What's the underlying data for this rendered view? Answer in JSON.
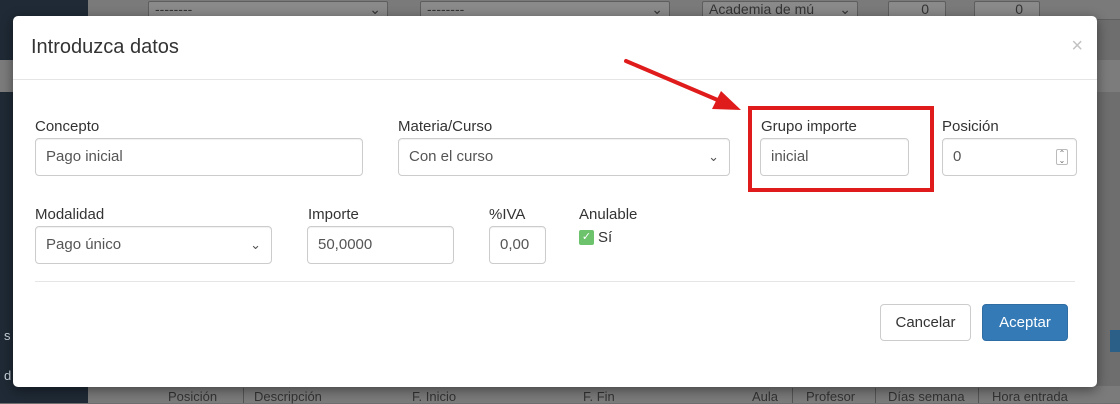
{
  "background": {
    "top_selects": [
      "--------",
      "--------",
      "Academia de mú",
      "0",
      "0"
    ],
    "left_edge_texts": [
      "s",
      "d"
    ],
    "table_headers": [
      "Posición",
      "Descripción",
      "F. Inicio",
      "F. Fin",
      "Aula",
      "Profesor",
      "Días semana",
      "Hora entrada"
    ]
  },
  "modal": {
    "title": "Introduzca datos",
    "close_symbol": "×",
    "fields": {
      "concepto": {
        "label": "Concepto",
        "value": "Pago inicial"
      },
      "materia": {
        "label": "Materia/Curso",
        "value": "Con el curso"
      },
      "grupo": {
        "label": "Grupo importe",
        "value": "inicial"
      },
      "posicion": {
        "label": "Posición",
        "value": "0"
      },
      "modalidad": {
        "label": "Modalidad",
        "value": "Pago único"
      },
      "importe": {
        "label": "Importe",
        "value": "50,0000"
      },
      "iva": {
        "label": "%IVA",
        "value": "0,00"
      },
      "anulable": {
        "label": "Anulable",
        "checkbox_label": "Sí",
        "checked": true
      }
    },
    "buttons": {
      "cancel": "Cancelar",
      "accept": "Aceptar"
    }
  },
  "annotation": {
    "color": "#e01b1b"
  },
  "colors": {
    "primary": "#337ab7",
    "check": "#6cc36c"
  }
}
